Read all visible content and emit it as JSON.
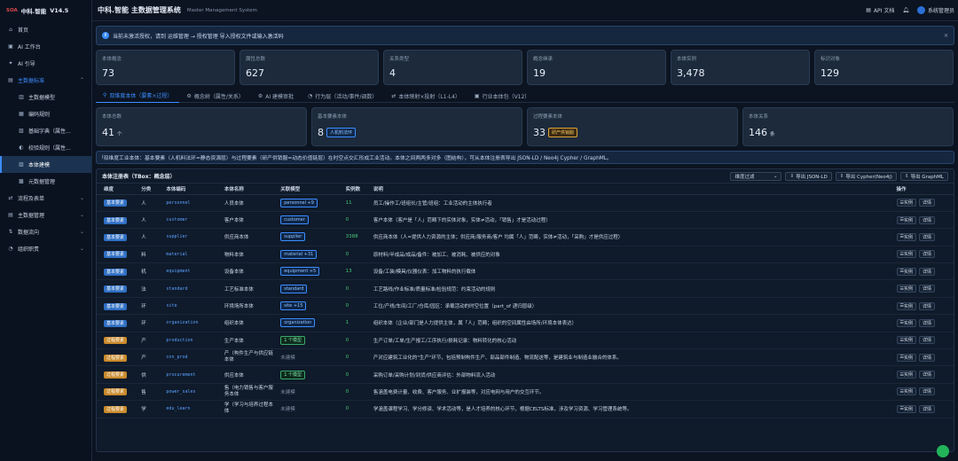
{
  "brand": {
    "logo": "SOA",
    "name": "中科.智能",
    "version": "V14.5"
  },
  "sidebar": {
    "items": [
      {
        "icon": "⌂",
        "label": "首页",
        "type": "top"
      },
      {
        "icon": "▣",
        "label": "AI 工作台",
        "type": "top"
      },
      {
        "icon": "✦",
        "label": "AI 引导",
        "type": "top"
      },
      {
        "icon": "▤",
        "label": "主数据标准",
        "type": "parent-open"
      },
      {
        "icon": "▥",
        "label": "主数据模型",
        "type": "sub"
      },
      {
        "icon": "▦",
        "label": "编码规则",
        "type": "sub"
      },
      {
        "icon": "▧",
        "label": "基础字典（属性...",
        "type": "sub"
      },
      {
        "icon": "◐",
        "label": "校验规则（属性...",
        "type": "sub"
      },
      {
        "icon": "▨",
        "label": "本体建模",
        "type": "active"
      },
      {
        "icon": "▩",
        "label": "元数据管理",
        "type": "sub"
      },
      {
        "icon": "⇄",
        "label": "流程及表单",
        "type": "top"
      },
      {
        "icon": "▤",
        "label": "主数据管理",
        "type": "top"
      },
      {
        "icon": "⇅",
        "label": "数据流向",
        "type": "top"
      },
      {
        "icon": "◔",
        "label": "组织职责",
        "type": "top"
      }
    ]
  },
  "topbar": {
    "title": "中科.智能 主数据管理系统",
    "subtitle": "Master Management System",
    "api_doc": "API 文档",
    "user": "系统管理员"
  },
  "alert": {
    "text": "当前未激活授权，请到 运维管理 → 授权管理 导入授权文件或输入激活码"
  },
  "stats": [
    {
      "label": "本体概念",
      "value": "73"
    },
    {
      "label": "属性总数",
      "value": "627"
    },
    {
      "label": "关系类型",
      "value": "4"
    },
    {
      "label": "概念继承",
      "value": "19"
    },
    {
      "label": "本体实例",
      "value": "3,478"
    },
    {
      "label": "标识对象",
      "value": "129"
    }
  ],
  "tabs": [
    {
      "icon": "⚲",
      "label": "双维度本体（要素×过程）",
      "active": true
    },
    {
      "icon": "⚙",
      "label": "概念树（属性/关系）",
      "active": false
    },
    {
      "icon": "⚙",
      "label": "AI 建模审批",
      "active": false
    },
    {
      "icon": "◔",
      "label": "行为层（活动/事件/调数）",
      "active": false
    },
    {
      "icon": "⇄",
      "label": "本体映射×投射（L1-L4）",
      "active": false
    },
    {
      "icon": "▣",
      "label": "行业本体包（V12）",
      "active": false
    }
  ],
  "stats2": [
    {
      "label": "本体总数",
      "value": "41",
      "unit": "个",
      "tag": "",
      "tag_type": ""
    },
    {
      "label": "基本要素本体",
      "value": "8",
      "unit": "",
      "tag": "人机料法环",
      "tag_type": "blue"
    },
    {
      "label": "过程要素本体",
      "value": "33",
      "unit": "",
      "tag": "研产供销服",
      "tag_type": "orange"
    },
    {
      "label": "本体关系",
      "value": "146",
      "unit": "条",
      "tag": "",
      "tag_type": ""
    }
  ],
  "alert2": {
    "text": "双维度工业本体：基本要素（人机料法环=静态资源层）与过程要素（研产供销服=动态价值链层）在时空点交汇形成工业活动。本体之间两两多对多（图结构），可从本体注册表导出 JSON-LD / Neo4j Cypher / GraphML。"
  },
  "registry": {
    "title": "本体注册表（TBox：概念层）",
    "filter": "维度过滤",
    "export_jsonld": "导出 JSON-LD",
    "export_cypher": "导出 Cypher(Neo4j)",
    "export_graphml": "导出 GraphML",
    "columns": [
      "维度",
      "分类",
      "本体编码",
      "本体名称",
      "关联模型",
      "实例数",
      "说明",
      "操作"
    ],
    "btn_instance": "实例",
    "btn_detail": "详情",
    "rows": [
      {
        "dim": "基本要素",
        "dim_type": "base",
        "cat": "人",
        "code": "personnel",
        "name": "人员本体",
        "model": "personnel +9",
        "model_type": "blue",
        "count": "11",
        "desc": "员工/操作工/班组长/主管/班组：工业活动的主体执行者"
      },
      {
        "dim": "基本要素",
        "dim_type": "base",
        "cat": "人",
        "code": "customer",
        "name": "客户本体",
        "model": "customer",
        "model_type": "blue",
        "count": "0",
        "desc": "客户本体（客户是「人」范畴下的实体对象，实体≠活动，「销售」才是活动过程）"
      },
      {
        "dim": "基本要素",
        "dim_type": "base",
        "cat": "人",
        "code": "supplier",
        "name": "供应商本体",
        "model": "supplier",
        "model_type": "blue",
        "count": "3388",
        "desc": "供应商本体（人=提供人力资源的主体；供应商/服务商/客户 均属「人」范畴，实体≠活动，「采购」才是供应过程）"
      },
      {
        "dim": "基本要素",
        "dim_type": "base",
        "cat": "料",
        "code": "material",
        "name": "物料本体",
        "model": "material +31",
        "model_type": "blue",
        "count": "0",
        "desc": "原材料/半成品/成品/备件：被加工、被消耗、被供应的对象"
      },
      {
        "dim": "基本要素",
        "dim_type": "base",
        "cat": "机",
        "code": "equipment",
        "name": "设备本体",
        "model": "equipment +5",
        "model_type": "blue",
        "count": "13",
        "desc": "设备/工装/模具/仪器仪表：加工物料的执行载体"
      },
      {
        "dim": "基本要素",
        "dim_type": "base",
        "cat": "法",
        "code": "standard",
        "name": "工艺标准本体",
        "model": "standard",
        "model_type": "blue",
        "count": "0",
        "desc": "工艺路线/作业标准/质量标准/检验规范：约束活动的规则"
      },
      {
        "dim": "基本要素",
        "dim_type": "base",
        "cat": "环",
        "code": "site",
        "name": "环境场所本体",
        "model": "site +15",
        "model_type": "blue",
        "count": "0",
        "desc": "工位/产线/车间/工厂/仓库/园区：承载活动的时空位置（part_of 递归层级）"
      },
      {
        "dim": "基本要素",
        "dim_type": "base",
        "cat": "环",
        "code": "organization",
        "name": "组织本体",
        "model": "organization",
        "model_type": "blue",
        "count": "1",
        "desc": "组织本体（企业/部门是人力提供主体，属「人」范畴；组织的空间属性由场所/环境本体表达）"
      },
      {
        "dim": "过程要素",
        "dim_type": "proc",
        "cat": "产",
        "code": "production",
        "name": "生产本体",
        "model": "1 个模型",
        "model_type": "green",
        "count": "0",
        "desc": "生产订单/工单/生产报工/工序执行/损耗记录：物料转化的核心活动"
      },
      {
        "dim": "过程要素",
        "dim_type": "proc",
        "cat": "产",
        "code": "cnn_prod",
        "name": "产（构件生产与供应链本体",
        "model": "未建模",
        "model_type": "none",
        "count": "0",
        "desc": "产对应建筑工业化的\"生产\"环节，包括预制构件生产、部品部件制造、物流配送等，是建筑业与制造业融合的体系。"
      },
      {
        "dim": "过程要素",
        "dim_type": "proc",
        "cat": "供",
        "code": "procurement",
        "name": "供应本体",
        "model": "1 个模型",
        "model_type": "green",
        "count": "0",
        "desc": "采购订单/采购计划/到货/供应商评估：外部物料流入活动"
      },
      {
        "dim": "过程要素",
        "dim_type": "proc",
        "cat": "售",
        "code": "power_sales",
        "name": "售（电力销售与客户服务本体",
        "model": "未建模",
        "model_type": "none",
        "count": "0",
        "desc": "售涵盖电费计量、收费、客户服务、业扩报装等，对应电网与用户的交互环节。"
      },
      {
        "dim": "过程要素",
        "dim_type": "proc",
        "cat": "学",
        "code": "edu_learn",
        "name": "学（学习与培养过程本体",
        "model": "未建模",
        "model_type": "none",
        "count": "0",
        "desc": "学涵盖课程学习、学分修读、学术活动等，是人才培养的核心环节，根据CELTS标准，涉及学习资源、学习管理系统等。"
      }
    ]
  }
}
